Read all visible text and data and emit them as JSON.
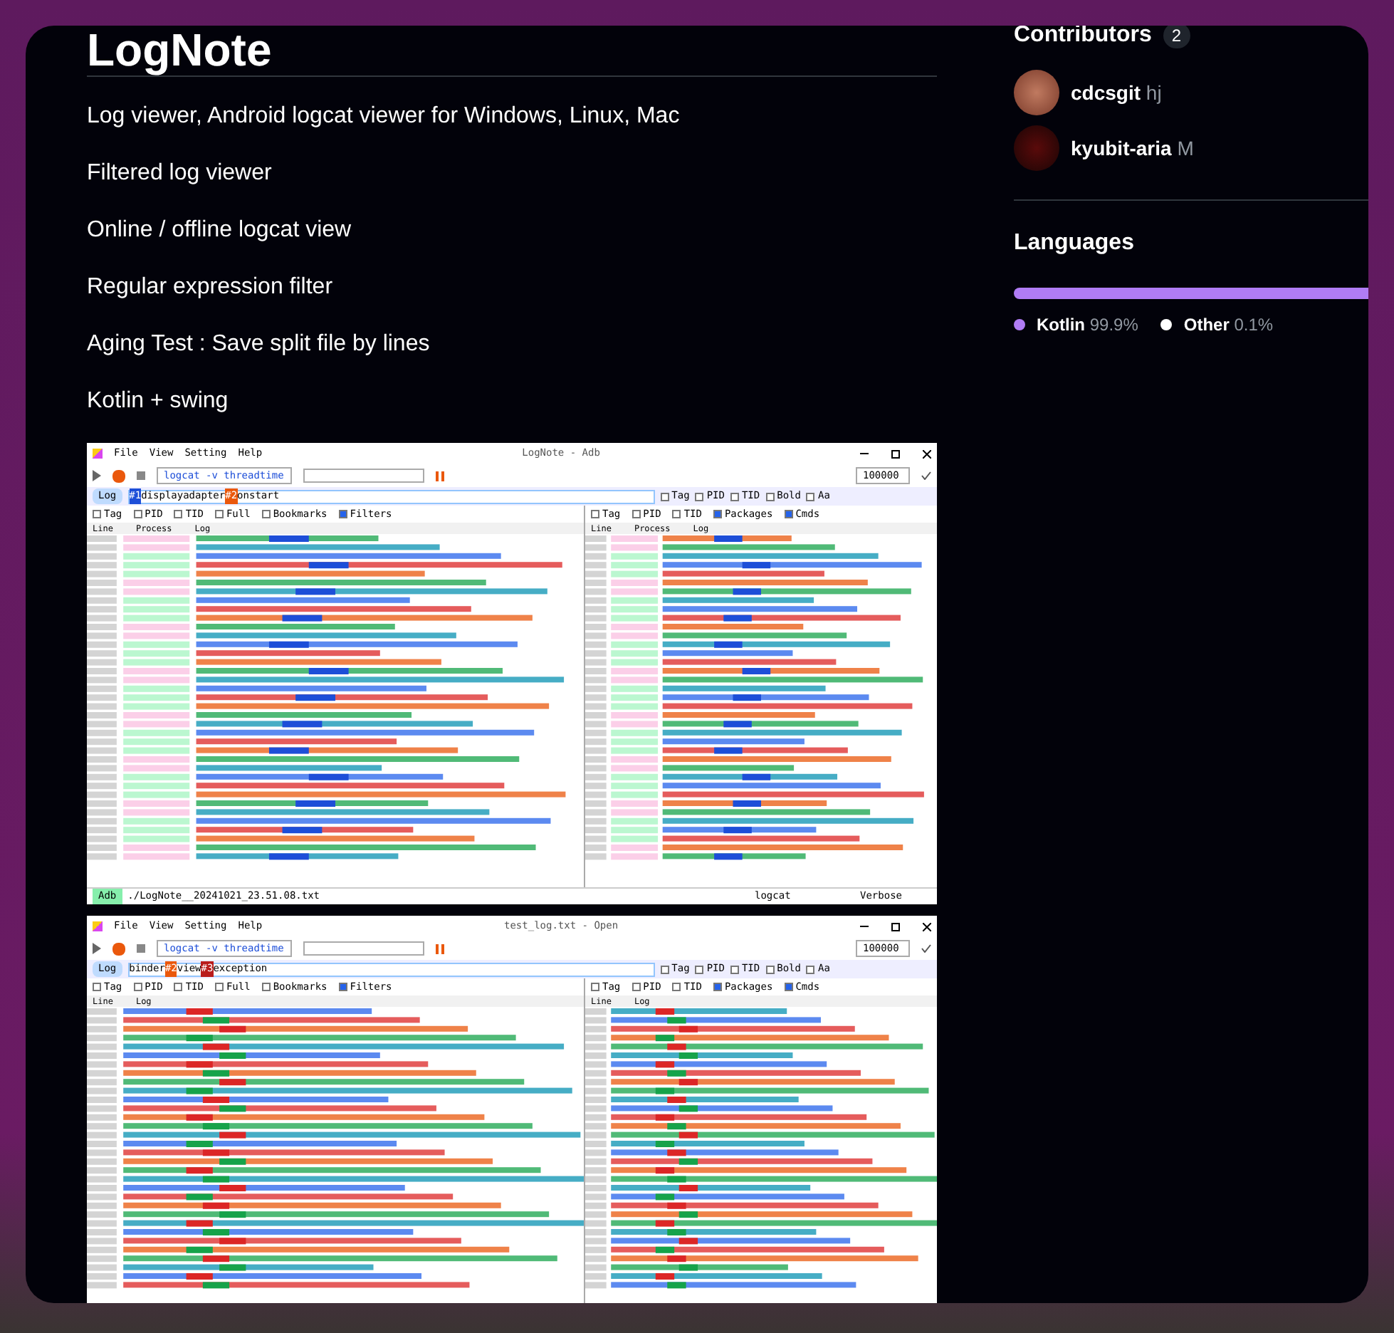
{
  "readme": {
    "title": "LogNote",
    "lines": [
      "Log viewer, Android logcat viewer for Windows, Linux, Mac",
      "Filtered log viewer",
      "Online / offline logcat view",
      "Regular expression filter",
      "Aging Test : Save split file by lines",
      "Kotlin + swing"
    ],
    "screenshots": [
      {
        "title": "LogNote - Adb",
        "menu": [
          "File",
          "View",
          "Setting",
          "Help"
        ],
        "command": "logcat -v threadtime",
        "count": "100000",
        "log_toggle": {
          "label": "Log",
          "checked": true
        },
        "filter_segments": [
          {
            "kind": "tag",
            "text": "#1",
            "color": "#1d4ed8"
          },
          {
            "kind": "text",
            "text": "displayadapter"
          },
          {
            "kind": "tag",
            "text": "#2",
            "color": "#ea580c"
          },
          {
            "kind": "text",
            "text": "onstart"
          }
        ],
        "options": [
          {
            "label": "Tag",
            "checked": false
          },
          {
            "label": "PID",
            "checked": false
          },
          {
            "label": "TID",
            "checked": false
          },
          {
            "label": "Bold",
            "checked": false
          },
          {
            "label": "Aa",
            "checked": false
          }
        ],
        "left_options": [
          {
            "label": "Tag",
            "checked": false
          },
          {
            "label": "PID",
            "checked": false
          },
          {
            "label": "TID",
            "checked": false
          },
          {
            "label": "Full",
            "checked": false
          },
          {
            "label": "Bookmarks",
            "checked": false
          },
          {
            "label": "Filters",
            "checked": true
          }
        ],
        "right_options": [
          {
            "label": "Tag",
            "checked": false
          },
          {
            "label": "PID",
            "checked": false
          },
          {
            "label": "TID",
            "checked": false
          },
          {
            "label": "Packages",
            "checked": true
          },
          {
            "label": "Cmds",
            "checked": true
          }
        ],
        "left_columns": [
          "Line",
          "Process",
          "Log"
        ],
        "right_columns": [
          "Line",
          "Process",
          "Log"
        ],
        "status_bar": {
          "badge": "Adb",
          "file": "./LogNote__20241021_23.51.08.txt",
          "device": "logcat",
          "level": "Verbose"
        }
      },
      {
        "title": "test_log.txt - Open",
        "menu": [
          "File",
          "View",
          "Setting",
          "Help"
        ],
        "command": "logcat -v threadtime",
        "count": "100000",
        "log_toggle": {
          "label": "Log",
          "checked": true
        },
        "filter_segments": [
          {
            "kind": "text",
            "text": "binder"
          },
          {
            "kind": "tag",
            "text": "#2",
            "color": "#ea580c"
          },
          {
            "kind": "text",
            "text": "view"
          },
          {
            "kind": "tag",
            "text": "#3",
            "color": "#b91c1c"
          },
          {
            "kind": "text",
            "text": "exception"
          }
        ],
        "options": [
          {
            "label": "Tag",
            "checked": false
          },
          {
            "label": "PID",
            "checked": false
          },
          {
            "label": "TID",
            "checked": false
          },
          {
            "label": "Bold",
            "checked": false
          },
          {
            "label": "Aa",
            "checked": false
          }
        ],
        "left_options": [
          {
            "label": "Tag",
            "checked": false
          },
          {
            "label": "PID",
            "checked": false
          },
          {
            "label": "TID",
            "checked": false
          },
          {
            "label": "Full",
            "checked": false
          },
          {
            "label": "Bookmarks",
            "checked": false
          },
          {
            "label": "Filters",
            "checked": true
          }
        ],
        "right_options": [
          {
            "label": "Tag",
            "checked": false
          },
          {
            "label": "PID",
            "checked": false
          },
          {
            "label": "TID",
            "checked": false
          },
          {
            "label": "Packages",
            "checked": true
          },
          {
            "label": "Cmds",
            "checked": true
          }
        ],
        "left_columns": [
          "Line",
          "Log"
        ],
        "right_columns": [
          "Line",
          "Log"
        ]
      }
    ]
  },
  "contributors": {
    "title": "Contributors",
    "count": "2",
    "people": [
      {
        "name": "cdcsgit",
        "handle": "hj"
      },
      {
        "name": "kyubit-aria",
        "handle": "M"
      }
    ]
  },
  "languages": {
    "title": "Languages",
    "items": [
      {
        "name": "Kotlin",
        "percent": "99.9%",
        "color": "#b07cf5",
        "level": 0.999
      },
      {
        "name": "Other",
        "percent": "0.1%",
        "color": "#ffffff"
      }
    ]
  }
}
